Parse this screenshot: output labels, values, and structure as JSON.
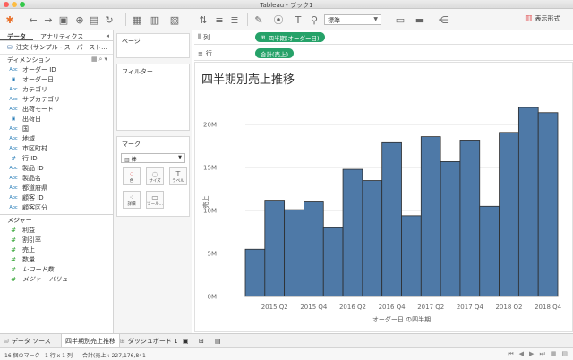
{
  "window": {
    "title": "Tableau - ブック1"
  },
  "toolbar": {
    "fit_select": "標準",
    "show_me": "表示形式"
  },
  "data_pane": {
    "tabs": [
      "データ",
      "アナリティクス"
    ],
    "datasource": "注文 (サンプル - スーパースト...",
    "dimensions_label": "ディメンション",
    "dimensions": [
      {
        "type": "Abc",
        "label": "オーダー ID"
      },
      {
        "type": "date",
        "label": "オーダー日"
      },
      {
        "type": "Abc",
        "label": "カテゴリ"
      },
      {
        "type": "Abc",
        "label": "サブカテゴリ"
      },
      {
        "type": "Abc",
        "label": "出荷モード"
      },
      {
        "type": "date",
        "label": "出荷日"
      },
      {
        "type": "Abc",
        "label": "国"
      },
      {
        "type": "Abc",
        "label": "地域"
      },
      {
        "type": "Abc",
        "label": "市区町村"
      },
      {
        "type": "#",
        "label": "行 ID"
      },
      {
        "type": "Abc",
        "label": "製品 ID"
      },
      {
        "type": "Abc",
        "label": "製品名"
      },
      {
        "type": "Abc",
        "label": "都道府県"
      },
      {
        "type": "Abc",
        "label": "顧客 ID"
      },
      {
        "type": "Abc",
        "label": "顧客区分"
      }
    ],
    "measures_label": "メジャー",
    "measures": [
      {
        "label": "利益"
      },
      {
        "label": "割引率"
      },
      {
        "label": "売上"
      },
      {
        "label": "数量"
      },
      {
        "label": "レコード数"
      },
      {
        "label": "メジャー バリュー"
      }
    ]
  },
  "shelves": {
    "pages": "ページ",
    "filters": "フィルター",
    "marks": "マーク",
    "mark_type": "棒",
    "mark_buttons": [
      "色",
      "サイズ",
      "ラベル",
      "詳細",
      "ツール..."
    ],
    "columns_label": "列",
    "rows_label": "行",
    "column_pill": "四半期(オーダー日)",
    "row_pill": "合計(売上)"
  },
  "view": {
    "title": "四半期別売上推移"
  },
  "chart_data": {
    "type": "bar",
    "title": "四半期別売上推移",
    "xlabel": "オーダー日 の四半期",
    "ylabel": "売上",
    "ylim": [
      0,
      22
    ],
    "y_unit": "M",
    "yticks": [
      "0M",
      "5M",
      "10M",
      "15M",
      "20M"
    ],
    "categories": [
      "2015 Q1",
      "2015 Q2",
      "2015 Q3",
      "2015 Q4",
      "2016 Q1",
      "2016 Q2",
      "2016 Q3",
      "2016 Q4",
      "2017 Q1",
      "2017 Q2",
      "2017 Q3",
      "2017 Q4",
      "2018 Q1",
      "2018 Q2",
      "2018 Q3",
      "2018 Q4"
    ],
    "x_tick_labels": [
      "2015 Q2",
      "2015 Q4",
      "2016 Q2",
      "2016 Q4",
      "2017 Q2",
      "2017 Q4",
      "2018 Q2",
      "2018 Q4"
    ],
    "values": [
      5.5,
      11.2,
      10.1,
      11.0,
      8.0,
      14.8,
      13.5,
      17.9,
      9.4,
      18.6,
      15.7,
      18.2,
      10.5,
      19.1,
      22.0,
      21.4
    ],
    "bar_color": "#4e79a7",
    "grid": true
  },
  "tabs": {
    "datasource": "データ ソース",
    "sheet": "四半期別売上推移",
    "dashboard": "ダッシュボード 1"
  },
  "status": {
    "marks": "16 個のマーク",
    "rows_cols": "1 行 x 1 列",
    "sum": "合計(売上): 227,176,841"
  }
}
